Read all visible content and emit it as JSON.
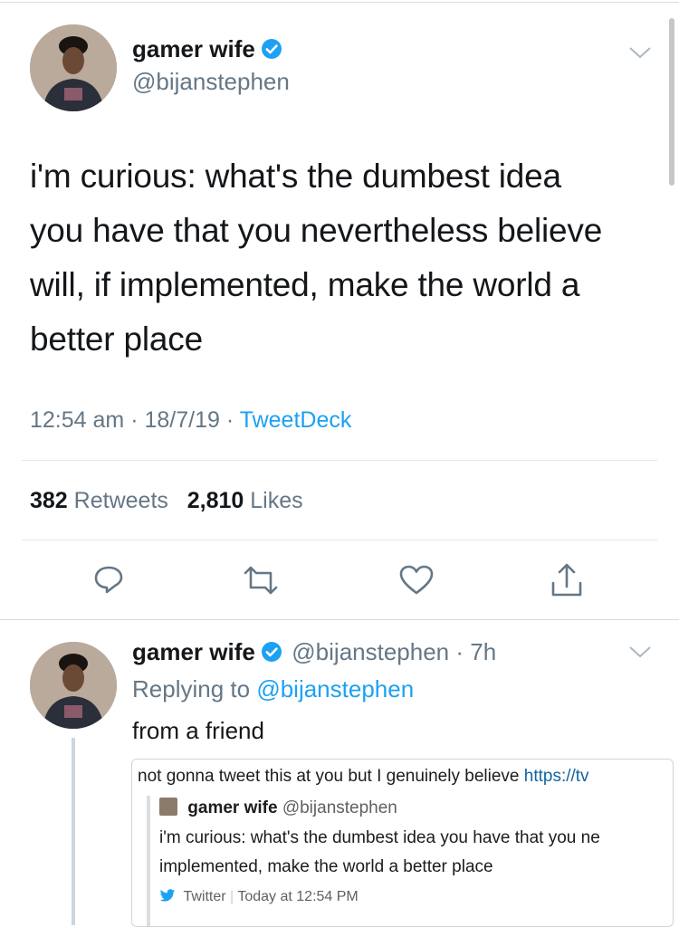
{
  "main_tweet": {
    "display_name": "gamer wife",
    "handle": "@bijanstephen",
    "text_lines": [
      "i'm curious: what's the dumbest idea",
      "you have that you nevertheless believe",
      "will, if implemented, make the world a",
      "better place"
    ],
    "time": "12:54 am",
    "date": "18/7/19",
    "source": "TweetDeck",
    "retweets_count": "382",
    "retweets_label": "Retweets",
    "likes_count": "2,810",
    "likes_label": "Likes"
  },
  "reply_tweet": {
    "display_name": "gamer wife",
    "handle": "@bijanstephen",
    "age": "7h",
    "replying_prefix": "Replying to",
    "replying_handle": "@bijanstephen",
    "text": "from a friend",
    "embed": {
      "line1_text": "not gonna tweet this at you but I genuinely believe ",
      "line1_link": "https://tv",
      "quoted_name": "gamer wife",
      "quoted_handle": "@bijanstephen",
      "quoted_line1": "i'm curious: what's the dumbest idea you have that you ne",
      "quoted_line2": "implemented, make the world a better place",
      "source": "Twitter",
      "timestamp": "Today at 12:54 PM"
    }
  },
  "colors": {
    "accent": "#1da1f2",
    "muted": "#657786",
    "divider": "#e1e8ed"
  },
  "icons": [
    "verified-badge-icon",
    "chevron-down-icon",
    "reply-icon",
    "retweet-icon",
    "like-icon",
    "share-icon",
    "twitter-bird-icon"
  ]
}
